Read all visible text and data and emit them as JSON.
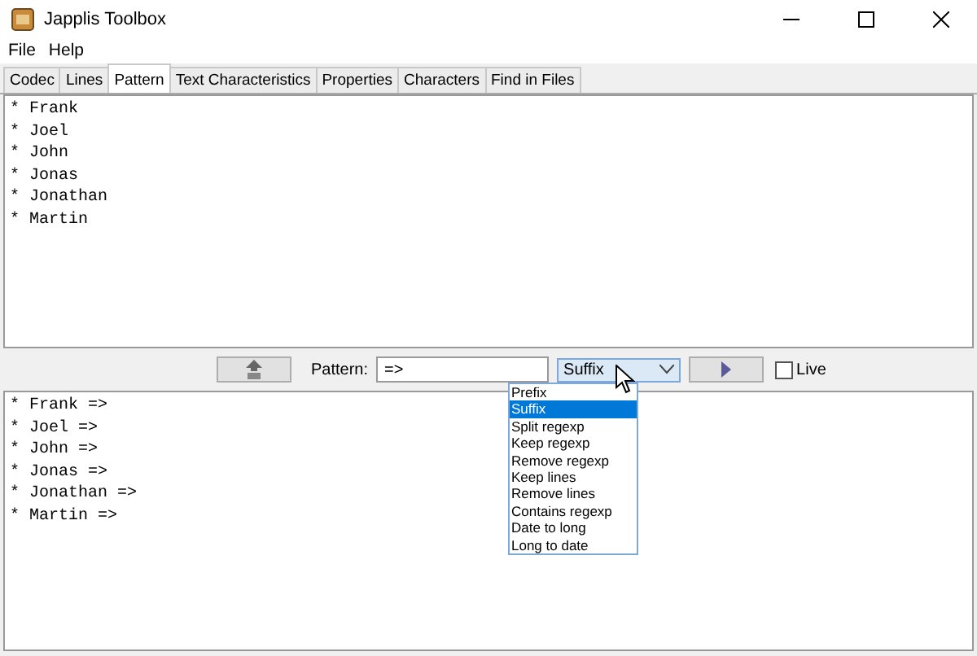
{
  "window": {
    "title": "Japplis Toolbox"
  },
  "menu": [
    "File",
    "Help"
  ],
  "tabs": [
    {
      "label": "Codec",
      "selected": false
    },
    {
      "label": "Lines",
      "selected": false
    },
    {
      "label": "Pattern",
      "selected": true
    },
    {
      "label": "Text Characteristics",
      "selected": false
    },
    {
      "label": "Properties",
      "selected": false
    },
    {
      "label": "Characters",
      "selected": false
    },
    {
      "label": "Find in Files",
      "selected": false
    }
  ],
  "input_lines": [
    "* Frank",
    "* Joel",
    "* John",
    "* Jonas",
    "* Jonathan",
    "* Martin"
  ],
  "toolbar": {
    "pattern_label": "Pattern:",
    "pattern_value": "=>",
    "mode_value": "Suffix",
    "live": {
      "label": "Live",
      "checked": false
    }
  },
  "dropdown": [
    {
      "label": "Prefix",
      "selected": false
    },
    {
      "label": "Suffix",
      "selected": true
    },
    {
      "label": "Split regexp",
      "selected": false
    },
    {
      "label": "Keep regexp",
      "selected": false
    },
    {
      "label": "Remove regexp",
      "selected": false
    },
    {
      "label": "Keep lines",
      "selected": false
    },
    {
      "label": "Remove lines",
      "selected": false
    },
    {
      "label": "Contains regexp",
      "selected": false
    },
    {
      "label": "Date to long",
      "selected": false
    },
    {
      "label": "Long to date",
      "selected": false
    }
  ],
  "output_lines": [
    "* Frank =>",
    "* Joel =>",
    "* John =>",
    "* Jonas =>",
    "* Jonathan =>",
    "* Martin =>"
  ]
}
